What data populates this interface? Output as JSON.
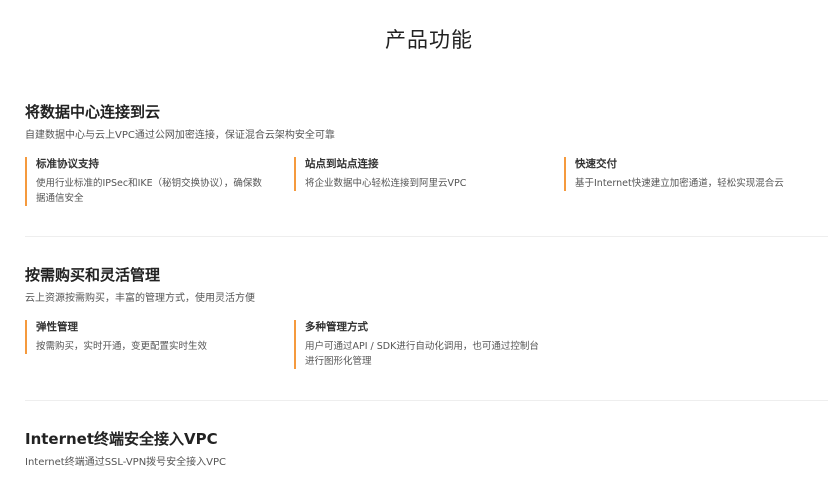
{
  "page": {
    "title": "产品功能"
  },
  "sections": [
    {
      "title": "将数据中心连接到云",
      "description": "自建数据中心与云上VPC通过公网加密连接，保证混合云架构安全可靠",
      "features": [
        {
          "title": "标准协议支持",
          "description_lines": [
            "使用行业标准的IPSec和IKE（秘钥交换协议），确保数",
            "据通信安全"
          ]
        },
        {
          "title": "站点到站点连接",
          "description_lines": [
            "将企业数据中心轻松连接到阿里云VPC"
          ]
        },
        {
          "title": "快速交付",
          "description_lines": [
            "基于Internet快速建立加密通道，轻松实现混合云"
          ]
        }
      ]
    },
    {
      "title": "按需购买和灵活管理",
      "description": "云上资源按需购买，丰富的管理方式，使用灵活方便",
      "features": [
        {
          "title": "弹性管理",
          "description_lines": [
            "按需购买，实时开通，变更配置实时生效"
          ]
        },
        {
          "title": "多种管理方式",
          "description_lines": [
            "用户可通过API / SDK进行自动化调用，也可通过控制台",
            "进行图形化管理"
          ]
        }
      ]
    },
    {
      "title": "Internet终端安全接入VPC",
      "description": "Internet终端通过SSL-VPN拨号安全接入VPC"
    }
  ],
  "colors": {
    "accent": "#f59a3e",
    "divider": "#eeeeee",
    "title": "#222222",
    "text": "#555555"
  }
}
